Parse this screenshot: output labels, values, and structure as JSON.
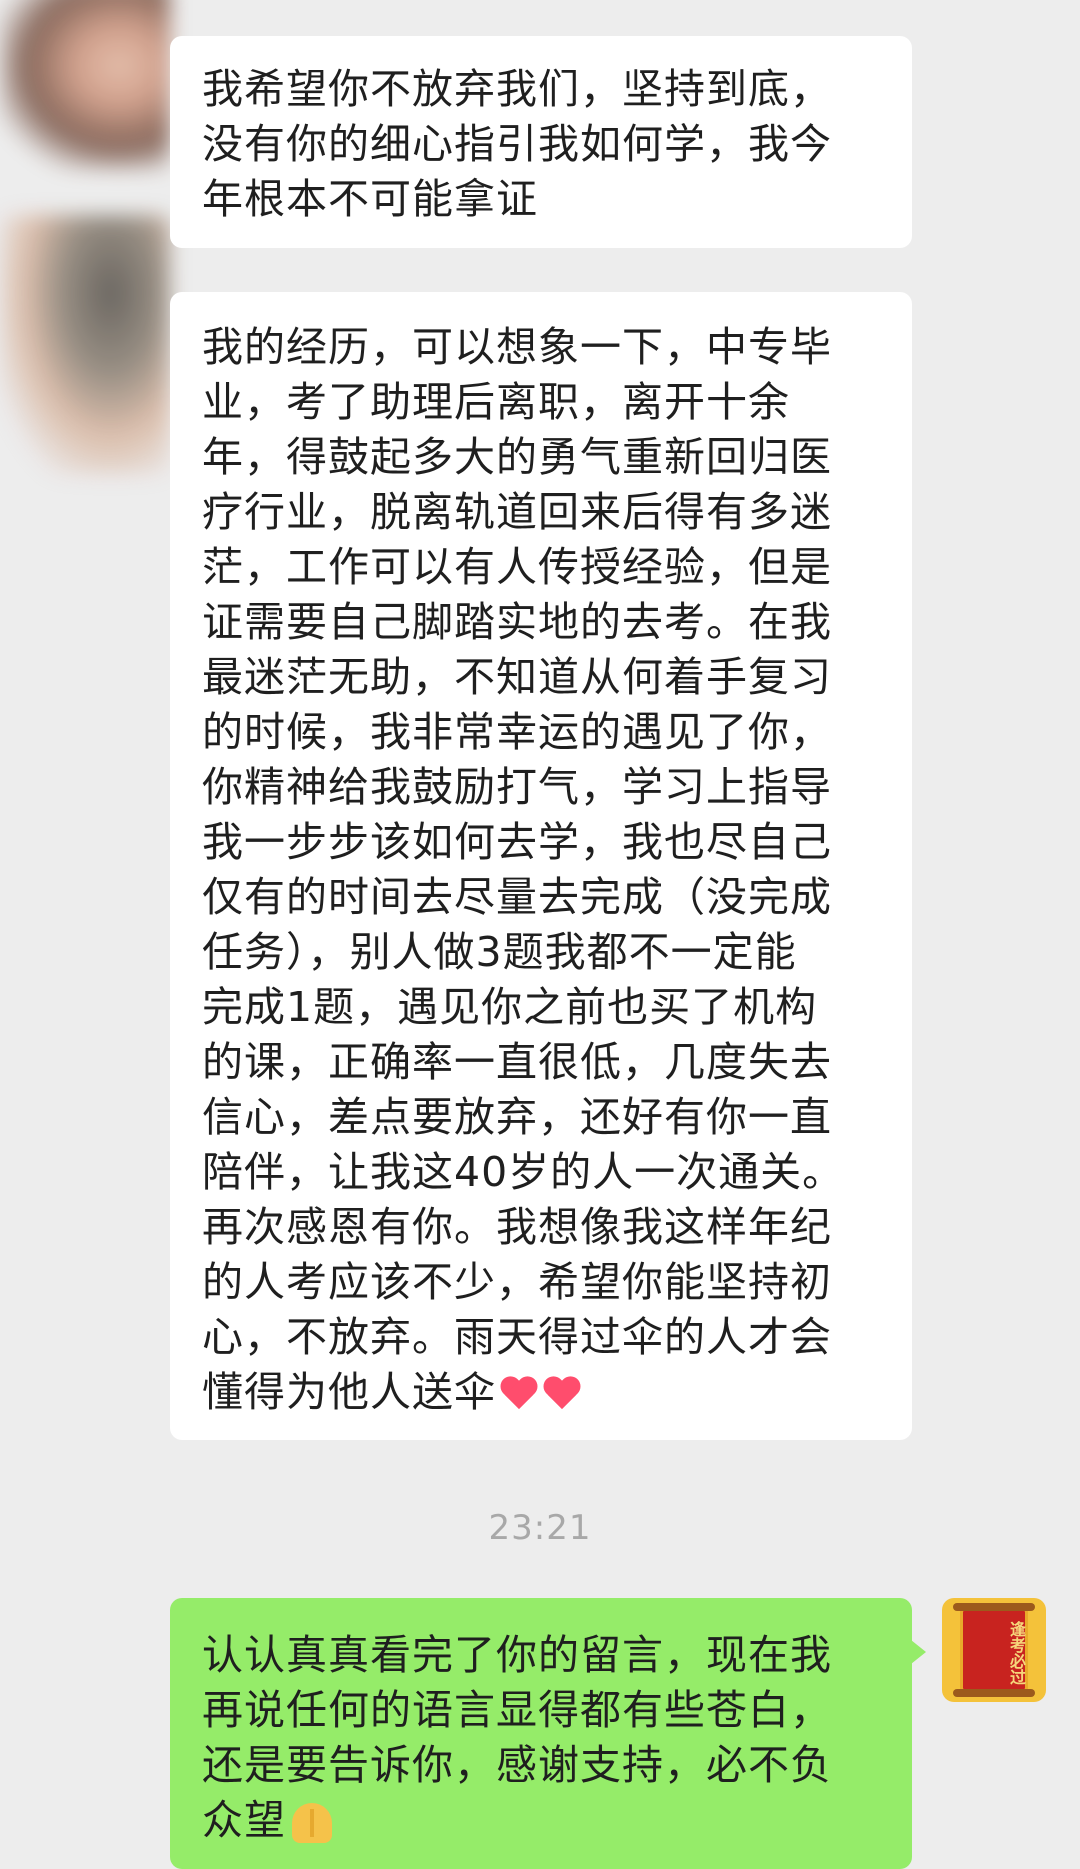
{
  "messages": [
    {
      "text": "我希望你不放弃我们，坚持到底，\n没有你的细心指引我如何学，我今\n年根本不可能拿证"
    },
    {
      "text": "我的经历，可以想象一下，中专毕\n业，考了助理后离职，离开十余\n年，得鼓起多大的勇气重新回归医\n疗行业，脱离轨道回来后得有多迷\n茫，工作可以有人传授经验，但是\n证需要自己脚踏实地的去考。在我\n最迷茫无助，不知道从何着手复习\n的时候，我非常幸运的遇见了你，\n你精神给我鼓励打气，学习上指导\n我一步步该如何去学，我也尽自己\n仅有的时间去尽量去完成（没完成\n任务），别人做3题我都不一定能\n完成1题，遇见你之前也买了机构\n的课，正确率一直很低，几度失去\n信心，差点要放弃，还好有你一直\n陪伴，让我这40岁的人一次通关。\n再次感恩有你。我想像我这样年纪\n的人考应该不少，希望你能坚持初\n心，不放弃。雨天得过伞的人才会\n懂得为他人送伞",
      "emojis": [
        "heart-icon",
        "heart-icon"
      ]
    }
  ],
  "timestamp": "23:21",
  "reply": {
    "text": "认认真真看完了你的留言，现在我\n再说任何的语言显得都有些苍白，\n还是要告诉你，感谢支持，必不负\n众望",
    "emojis": [
      "folded-hands-icon"
    ]
  },
  "my_avatar": {
    "text": "逢考必过"
  },
  "colors": {
    "background": "#ededed",
    "incoming_bubble": "#ffffff",
    "outgoing_bubble": "#95ec69",
    "timestamp": "#a8a8a8"
  }
}
